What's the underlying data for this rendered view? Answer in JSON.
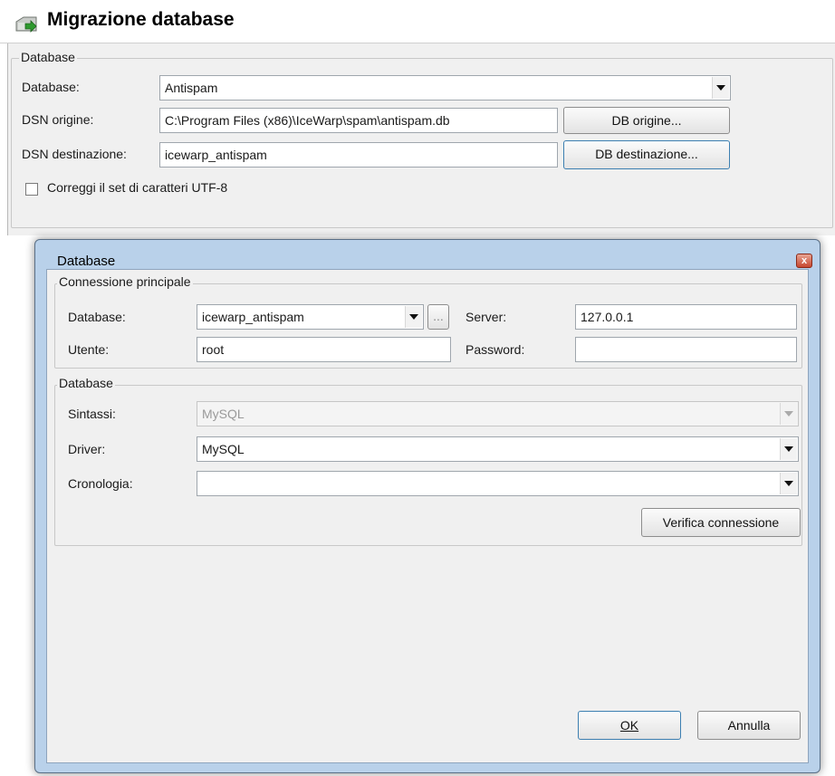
{
  "header": {
    "title": "Migrazione database"
  },
  "database_group": {
    "legend": "Database",
    "database_label": "Database:",
    "database_value": "Antispam",
    "dsn_source_label": "DSN origine:",
    "dsn_source_value": "C:\\Program Files (x86)\\IceWarp\\spam\\antispam.db",
    "dsn_source_button": "DB origine...",
    "dsn_dest_label": "DSN destinazione:",
    "dsn_dest_value": "icewarp_antispam",
    "dsn_dest_button": "DB destinazione...",
    "utf8_checkbox_label": "Correggi il set di caratteri UTF-8",
    "utf8_checked": false
  },
  "dialog": {
    "title": "Database",
    "close_glyph": "x",
    "connection": {
      "legend": "Connessione principale",
      "database_label": "Database:",
      "database_value": "icewarp_antispam",
      "browse_button": "...",
      "server_label": "Server:",
      "server_value": "127.0.0.1",
      "user_label": "Utente:",
      "user_value": "root",
      "password_label": "Password:",
      "password_value": ""
    },
    "db": {
      "legend": "Database",
      "syntax_label": "Sintassi:",
      "syntax_value": "MySQL",
      "driver_label": "Driver:",
      "driver_value": "MySQL",
      "history_label": "Cronologia:",
      "history_value": "",
      "verify_button": "Verifica connessione"
    },
    "ok_button": "OK",
    "cancel_button": "Annulla"
  },
  "colors": {
    "panel": "#f0f0f0",
    "dialog_frame": "#b9d1ea",
    "close": "#c7472f"
  },
  "icons": [
    "database-migration-icon",
    "close-icon",
    "dropdown-arrow-icon"
  ]
}
